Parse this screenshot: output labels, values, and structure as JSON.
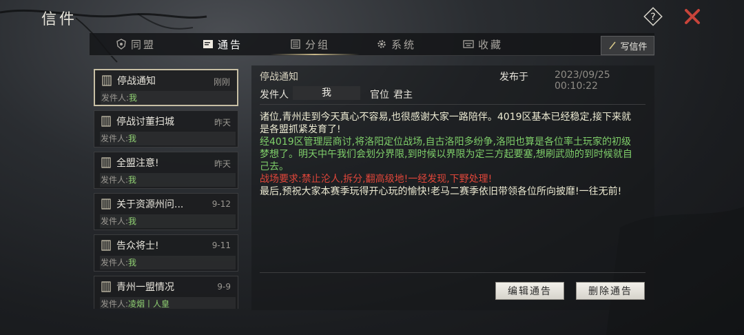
{
  "window": {
    "title": "信件"
  },
  "header": {
    "help_icon": "question-diamond-icon",
    "close_icon": "red-x-close-icon"
  },
  "tabs": [
    {
      "label": "同盟",
      "icon": "alliance-emblem-icon",
      "active": false
    },
    {
      "label": "通告",
      "icon": "notice-board-icon",
      "active": true
    },
    {
      "label": "分组",
      "icon": "group-list-icon",
      "active": false
    },
    {
      "label": "系统",
      "icon": "gear-icon",
      "active": false
    },
    {
      "label": "收藏",
      "icon": "archive-box-icon",
      "active": false
    }
  ],
  "write_button": {
    "label": "写信件",
    "icon": "pen-icon"
  },
  "mail_list": [
    {
      "title": "停战通知",
      "time": "刚刚",
      "sender_label": "发件人:",
      "sender": "我",
      "selected": true
    },
    {
      "title": "停战讨董扫城",
      "time": "昨天",
      "sender_label": "发件人:",
      "sender": "我",
      "selected": false
    },
    {
      "title": "全盟注意!",
      "time": "昨天",
      "sender_label": "发件人:",
      "sender": "我",
      "selected": false
    },
    {
      "title": "关于资源州问...",
      "time": "9-12",
      "sender_label": "发件人:",
      "sender": "我",
      "selected": false
    },
    {
      "title": "告众将士!",
      "time": "9-11",
      "sender_label": "发件人:",
      "sender": "我",
      "selected": false
    },
    {
      "title": "青州一盟情况",
      "time": "9-9",
      "sender_label": "发件人:",
      "sender": "凌烟丨人皇",
      "selected": false
    }
  ],
  "detail": {
    "title": "停战通知",
    "published_label": "发布于",
    "published_time": "2023/09/25 00:10:22",
    "sender_label": "发件人",
    "sender": "我",
    "rank_label": "官位",
    "rank": "君主",
    "body": {
      "p1": "诸位,青州走到今天真心不容易,也很感谢大家一路陪伴。4019区基本已经稳定,接下来就是各盟抓紧发育了!",
      "p2": "经4019区管理层商讨,将洛阳定位战场,自古洛阳多纷争,洛阳也算是各位率土玩家的初级梦想了。明天中午我们会划分界限,到时候以界限为定三方起要塞,想刷武勋的到时候就自己去。",
      "p3": "战场要求:禁止沦人,拆分,翻高级地!一经发现,下野处理!",
      "p4": "最后,预祝大家本赛季玩得开心玩的愉快!老马二赛季依旧带领各位所向披靡!一往无前!"
    }
  },
  "actions": {
    "edit_label": "编辑通告",
    "delete_label": "删除通告"
  },
  "colors": {
    "highlight_green": "#7fcf6a",
    "warning_red": "#e0463a",
    "close_red": "#c8443a",
    "selected_border": "#c8c0a5"
  }
}
